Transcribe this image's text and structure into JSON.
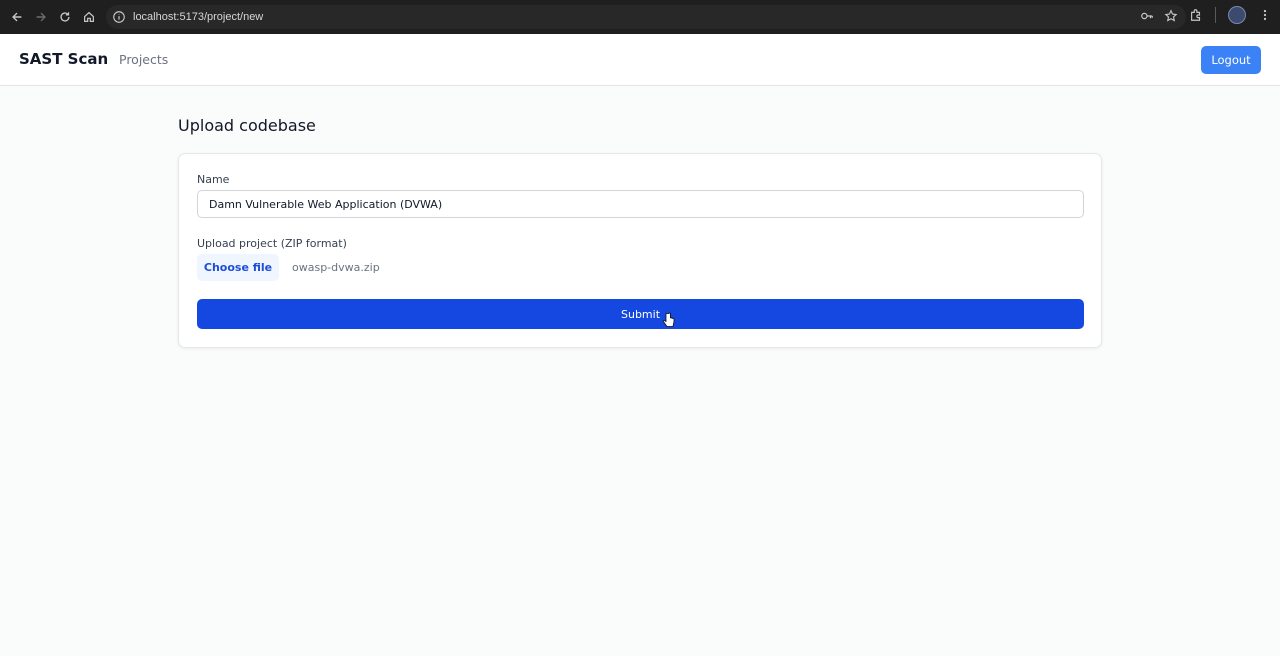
{
  "browser": {
    "url": "localhost:5173/project/new"
  },
  "header": {
    "brand": "SAST Scan",
    "nav_projects": "Projects",
    "logout_label": "Logout"
  },
  "main": {
    "title": "Upload codebase",
    "form": {
      "name_label": "Name",
      "name_value": "Damn Vulnerable Web Application (DVWA)",
      "upload_label": "Upload project (ZIP format)",
      "choose_file_label": "Choose file",
      "file_name": "owasp-dvwa.zip",
      "submit_label": "Submit"
    }
  },
  "colors": {
    "submit": "#1448e0",
    "logout": "#3b82f6",
    "file_button_bg": "#eff6ff"
  }
}
